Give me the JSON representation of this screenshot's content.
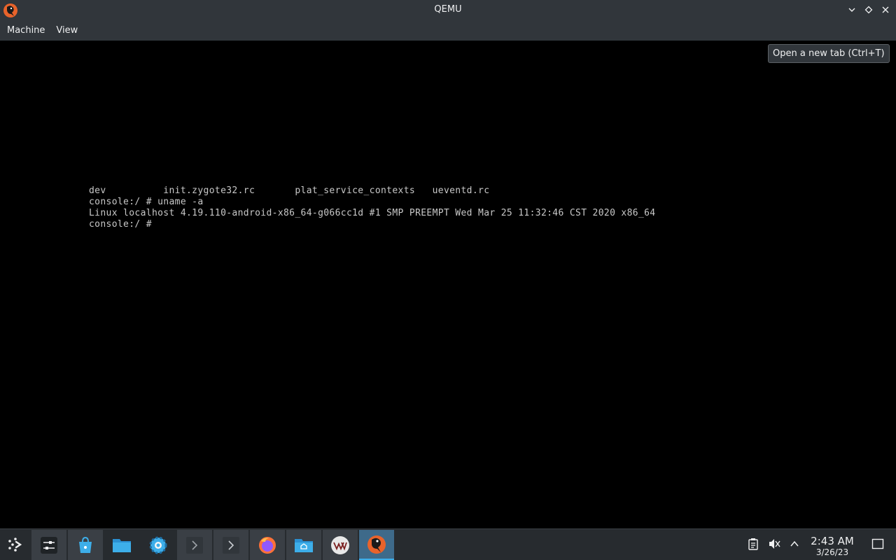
{
  "window": {
    "title": "QEMU",
    "controls": [
      "minimize-icon",
      "maximize-icon",
      "close-icon"
    ]
  },
  "menu": {
    "items": [
      "Machine",
      "View"
    ]
  },
  "tooltip": {
    "text": "Open a new tab (Ctrl+T)"
  },
  "console": {
    "lines": [
      "dev          init.zygote32.rc       plat_service_contexts   ueventd.rc",
      "console:/ # uname -a",
      "Linux localhost 4.19.110-android-x86_64-g066cc1d #1 SMP PREEMPT Wed Mar 25 11:32:46 CST 2020 x86_64",
      "console:/ #"
    ]
  },
  "taskbar": {
    "launcher_icon": "application-launcher-icon",
    "apps": [
      "system-settings-icon",
      "discover-store-icon",
      "file-manager-icon",
      "settings-gear-icon",
      "terminal-icon",
      "terminal-icon",
      "firefox-icon",
      "home-folder-icon",
      "virt-manager-icon",
      "qemu-icon"
    ],
    "tray": [
      "clipboard-icon",
      "volume-muted-icon",
      "expand-tray-icon"
    ],
    "clock": {
      "time": "2:43 AM",
      "date": "3/26/23"
    },
    "show_desktop_icon": "show-desktop-icon"
  },
  "colors": {
    "titlebar": "#31363b",
    "taskbar": "#272b2f",
    "accent": "#3daee9",
    "console_text": "#c8c8c8"
  }
}
